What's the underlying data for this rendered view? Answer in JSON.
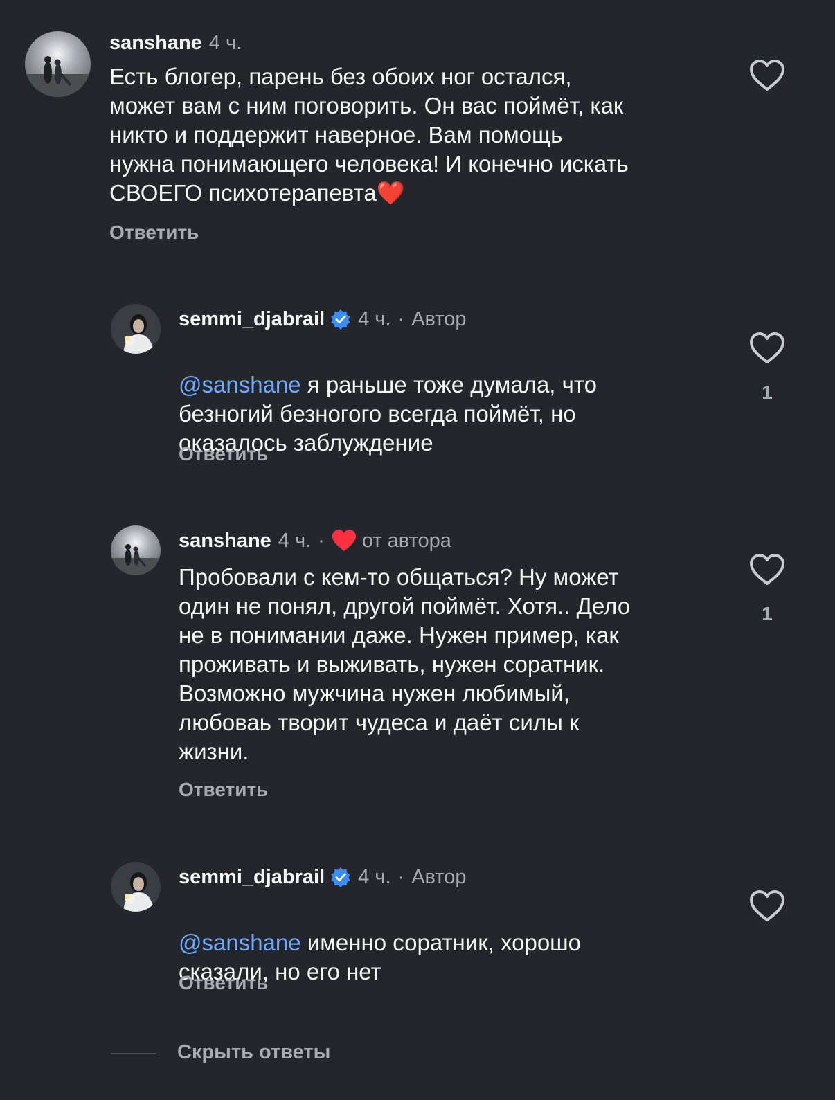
{
  "comments": [
    {
      "username": "sanshane",
      "time": "4 ч.",
      "text": "Есть блогер, парень без обоих ног остался,\nможет вам с ним поговорить. Он вас поймёт, как\nникто и поддержит наверное. Вам помощь\nнужна понимающего человека! И конечно искать\nСВОЕГО психотерапевта❤️",
      "reply_label": "Ответить",
      "like_icon": "heart-outline-icon"
    },
    {
      "username": "semmi_djabrail",
      "time": "4 ч.",
      "role": "Автор",
      "mention": "@sanshane",
      "text": " я раньше тоже думала, что\nбезногий безногого всегда поймёт, но\nоказалось заблуждение",
      "reply_label": "Ответить",
      "like_count": "1",
      "like_icon": "heart-outline-icon",
      "verified_icon": "verified-badge-icon",
      "verified_color": "#3b8cf5"
    },
    {
      "username": "sanshane",
      "time": "4 ч.",
      "liked_by_author": "от автора",
      "text": "Пробовали с кем-то общаться? Ну может\nодин не понял, другой поймёт. Хотя.. Дело\nне в понимании даже. Нужен пример, как\nпроживать и выживать, нужен соратник.\nВозможно мужчина нужен любимый,\nлюбоваь творит чудеса и даёт силы к\nжизни.",
      "reply_label": "Ответить",
      "like_count": "1",
      "like_icon": "heart-outline-icon",
      "author_heart_color": "#ff3040"
    },
    {
      "username": "semmi_djabrail",
      "time": "4 ч.",
      "role": "Автор",
      "mention": "@sanshane",
      "text": " именно соратник, хорошо\nсказали, но его нет",
      "reply_label": "Ответить",
      "like_icon": "heart-outline-icon",
      "verified_icon": "verified-badge-icon",
      "verified_color": "#3b8cf5"
    }
  ],
  "hide_replies_label": "Скрыть ответы",
  "colors": {
    "background": "#24262b",
    "text": "#f5f5f5",
    "secondary_text": "#a8abb1",
    "mention": "#6fa8ff"
  }
}
